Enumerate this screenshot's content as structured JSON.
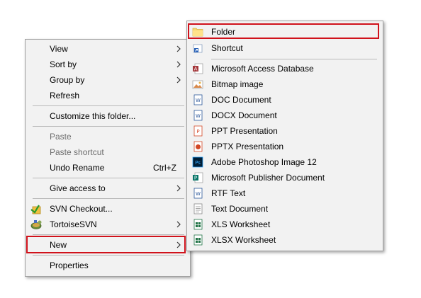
{
  "main_menu": {
    "items": [
      {
        "label": "View",
        "submenu": true,
        "enabled": true
      },
      {
        "label": "Sort by",
        "submenu": true,
        "enabled": true
      },
      {
        "label": "Group by",
        "submenu": true,
        "enabled": true
      },
      {
        "label": "Refresh",
        "enabled": true
      },
      {
        "label": "Customize this folder...",
        "enabled": true
      },
      {
        "label": "Paste",
        "enabled": false
      },
      {
        "label": "Paste shortcut",
        "enabled": false
      },
      {
        "label": "Undo Rename",
        "shortcut": "Ctrl+Z",
        "enabled": true
      },
      {
        "label": "Give access to",
        "submenu": true,
        "enabled": true
      },
      {
        "label": "SVN Checkout...",
        "icon": "svn-checkout-icon",
        "enabled": true
      },
      {
        "label": "TortoiseSVN",
        "icon": "tortoisesvn-icon",
        "submenu": true,
        "enabled": true
      },
      {
        "label": "New",
        "submenu": true,
        "highlighted": true,
        "enabled": true
      },
      {
        "label": "Properties",
        "enabled": true
      }
    ]
  },
  "new_submenu": {
    "items": [
      {
        "label": "Folder",
        "icon": "folder-icon",
        "highlighted": true
      },
      {
        "label": "Shortcut",
        "icon": "shortcut-icon"
      },
      {
        "label": "Microsoft Access Database",
        "icon": "access-database-icon"
      },
      {
        "label": "Bitmap image",
        "icon": "bitmap-image-icon"
      },
      {
        "label": "DOC Document",
        "icon": "doc-document-icon"
      },
      {
        "label": "DOCX Document",
        "icon": "docx-document-icon"
      },
      {
        "label": "PPT Presentation",
        "icon": "ppt-presentation-icon"
      },
      {
        "label": "PPTX Presentation",
        "icon": "pptx-presentation-icon"
      },
      {
        "label": "Adobe Photoshop Image 12",
        "icon": "photoshop-image-icon"
      },
      {
        "label": "Microsoft Publisher Document",
        "icon": "publisher-document-icon"
      },
      {
        "label": "RTF Text",
        "icon": "rtf-text-icon"
      },
      {
        "label": "Text Document",
        "icon": "text-document-icon"
      },
      {
        "label": "XLS Worksheet",
        "icon": "xls-worksheet-icon"
      },
      {
        "label": "XLSX Worksheet",
        "icon": "xlsx-worksheet-icon"
      }
    ]
  },
  "colors": {
    "menu_background": "#f2f2f2",
    "highlight_border": "#d0121b",
    "disabled_text": "#6d6d6d",
    "separator": "#b9b9b9"
  }
}
